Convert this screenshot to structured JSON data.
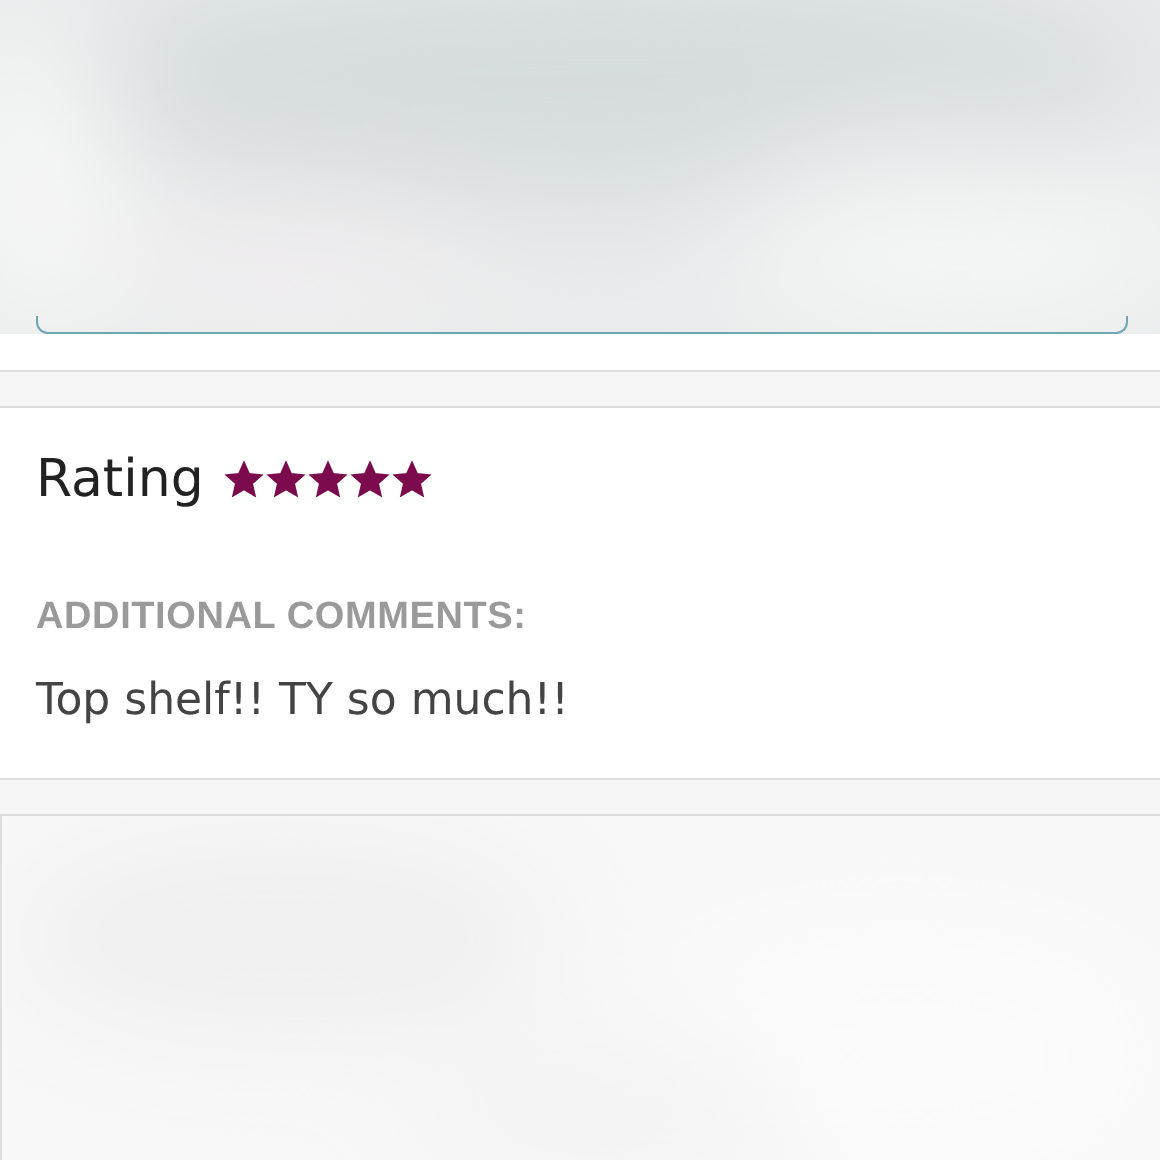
{
  "rating": {
    "label": "Rating",
    "stars": 5
  },
  "comments": {
    "heading": "ADDITIONAL COMMENTS:",
    "text": "Top shelf!! TY so much!!"
  }
}
